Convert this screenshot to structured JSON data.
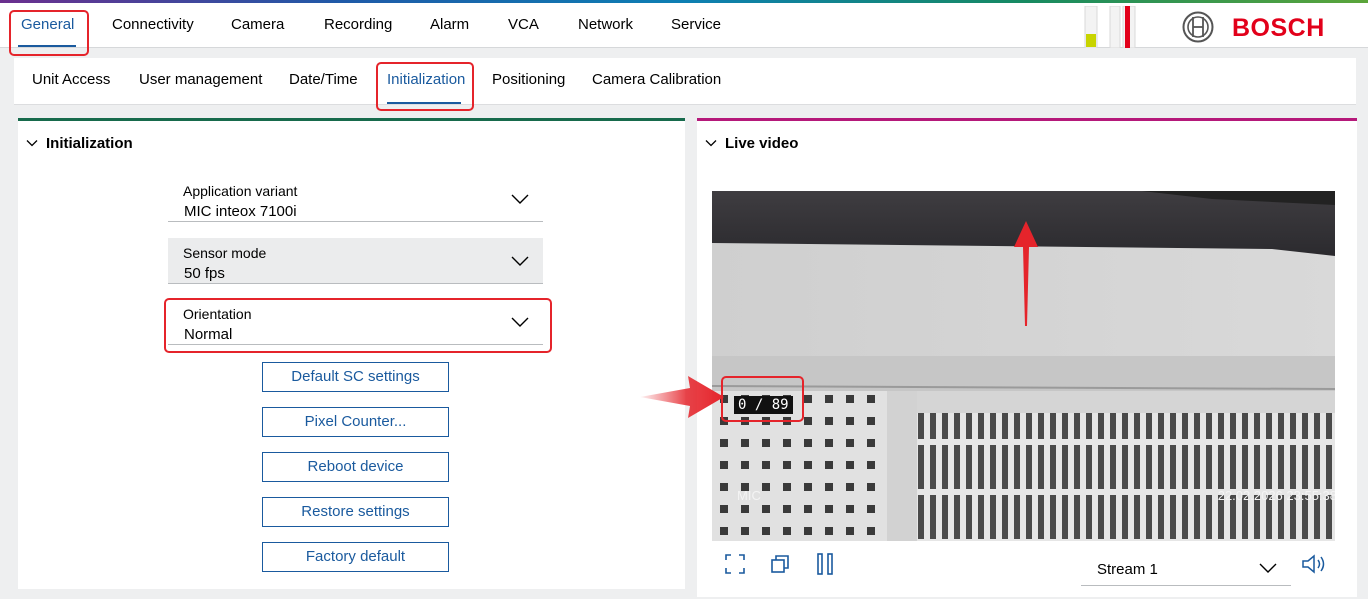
{
  "top_nav": {
    "tabs": [
      {
        "label": "General",
        "active": true
      },
      {
        "label": "Connectivity"
      },
      {
        "label": "Camera"
      },
      {
        "label": "Recording"
      },
      {
        "label": "Alarm"
      },
      {
        "label": "VCA"
      },
      {
        "label": "Network"
      },
      {
        "label": "Service"
      }
    ]
  },
  "brand": {
    "name": "BOSCH",
    "color": "#e2001a"
  },
  "sub_nav": {
    "tabs": [
      {
        "label": "Unit Access"
      },
      {
        "label": "User management"
      },
      {
        "label": "Date/Time"
      },
      {
        "label": "Initialization",
        "active": true
      },
      {
        "label": "Positioning"
      },
      {
        "label": "Camera Calibration"
      }
    ]
  },
  "init_panel": {
    "title": "Initialization",
    "fields": [
      {
        "label": "Application variant",
        "value": "MIC inteox 7100i"
      },
      {
        "label": "Sensor mode",
        "value": "50 fps"
      },
      {
        "label": "Orientation",
        "value": "Normal"
      }
    ],
    "buttons": [
      "Default SC settings",
      "Pixel Counter...",
      "Reboot device",
      "Restore settings",
      "Factory default"
    ]
  },
  "video_panel": {
    "title": "Live video",
    "overlay_counter": "0 / 89",
    "overlay_model": "MIC",
    "overlay_timestamp": "22.02.2026 23:55:38",
    "stream_value": "Stream 1"
  },
  "icons": {
    "fullscreen": "fullscreen-icon",
    "window": "window-icon",
    "pause": "pause-icon",
    "speaker": "speaker-icon",
    "chevron": "chevron-down-icon"
  },
  "colors": {
    "accent": "#1a5a9e",
    "highlight": "#e5242b",
    "left_panel_bar": "#176a4c",
    "right_panel_bar": "#b5197a"
  }
}
